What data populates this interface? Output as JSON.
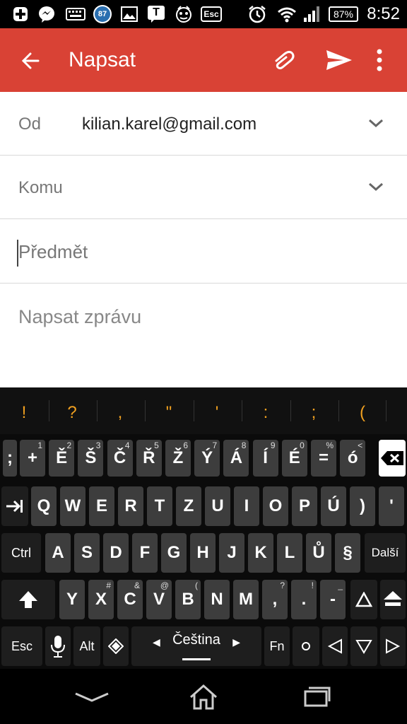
{
  "status_bar": {
    "time": "8:52",
    "battery": "87%",
    "badge_87": "87",
    "icons": [
      "plus-icon",
      "messenger-icon",
      "keyboard-icon",
      "badge-icon",
      "image-icon",
      "t-icon",
      "robot-icon",
      "esc-icon",
      "alarm-icon",
      "wifi-icon",
      "signal-icon",
      "battery-icon"
    ],
    "esc_label": "Esc",
    "t_label": "T"
  },
  "appbar": {
    "title": "Napsat",
    "color": "#d94235"
  },
  "compose": {
    "from_label": "Od",
    "from_value": "kilian.karel@gmail.com",
    "to_label": "Komu",
    "subject_placeholder": "Předmět",
    "body_placeholder": "Napsat zprávu"
  },
  "keyboard": {
    "suggestions": [
      "!",
      "?",
      ",",
      "\"",
      "'",
      ":",
      ";",
      "("
    ],
    "row1": [
      ";",
      "+",
      "Ě",
      "Š",
      "Č",
      "Ř",
      "Ž",
      "Ý",
      "Á",
      "Í",
      "É",
      "=",
      "ó"
    ],
    "row1_sub": [
      "",
      "1",
      "2",
      "3",
      "4",
      "5",
      "6",
      "7",
      "8",
      "9",
      "0",
      "%",
      "<"
    ],
    "row2": [
      "Q",
      "W",
      "E",
      "R",
      "T",
      "Z",
      "U",
      "I",
      "O",
      "P",
      "Ú",
      ")",
      "'"
    ],
    "row3": [
      "A",
      "S",
      "D",
      "F",
      "G",
      "H",
      "J",
      "K",
      "L",
      "Ů",
      "§"
    ],
    "row3_ctrl": "Ctrl",
    "row3_next": "Další",
    "row4": [
      "Y",
      "X",
      "C",
      "V",
      "B",
      "N",
      "M",
      ",",
      ".",
      "-"
    ],
    "row4_sub": [
      "",
      "#",
      "&",
      "@",
      "(",
      "",
      "",
      "?",
      "!",
      "_"
    ],
    "row5": {
      "esc": "Esc",
      "alt": "Alt",
      "language": "Čeština",
      "fn": "Fn"
    }
  }
}
